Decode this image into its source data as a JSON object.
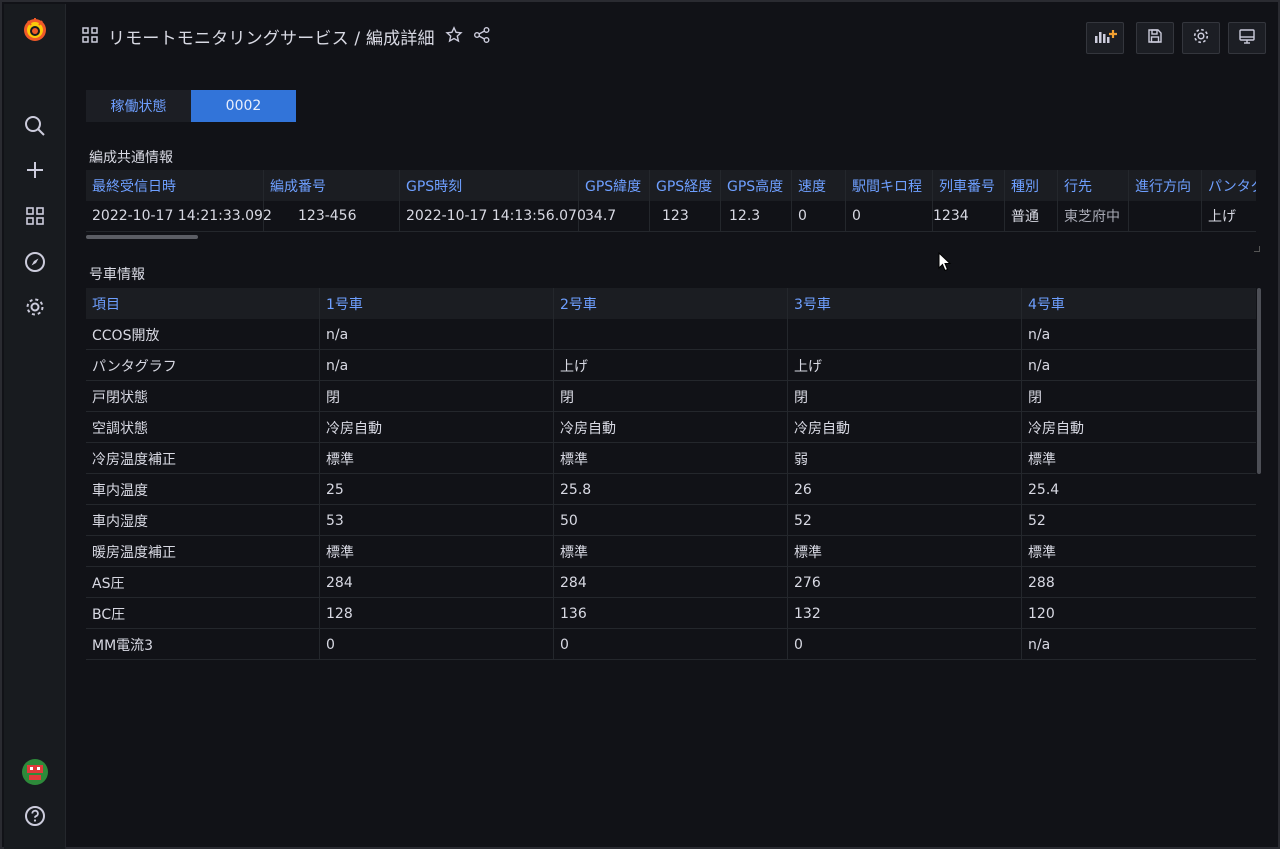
{
  "topbar": {
    "title": "リモートモニタリングサービス / 編成詳細"
  },
  "tabs": [
    {
      "label": "稼働状態"
    },
    {
      "label": "0002"
    }
  ],
  "common_info": {
    "title": "編成共通情報",
    "columns": [
      "最終受信日時",
      "編成番号",
      "GPS時刻",
      "GPS緯度",
      "GPS経度",
      "GPS高度",
      "速度",
      "駅間キロ程",
      "列車番号",
      "種別",
      "行先",
      "進行方向",
      "パンタグ"
    ],
    "row": [
      "2022-10-17 14:21:33.092",
      "123-456",
      "2022-10-17 14:13:56.070",
      "34.7",
      "123",
      "12.3",
      "0",
      "0",
      "1234",
      "普通",
      "東芝府中",
      "",
      "上げ"
    ]
  },
  "car_info": {
    "title": "号車情報",
    "columns": [
      "項目",
      "1号車",
      "2号車",
      "3号車",
      "4号車"
    ],
    "rows": [
      [
        "CCOS開放",
        "n/a",
        "",
        "",
        "n/a"
      ],
      [
        "パンタグラフ",
        "n/a",
        "上げ",
        "上げ",
        "n/a"
      ],
      [
        "戸閉状態",
        "閉",
        "閉",
        "閉",
        "閉"
      ],
      [
        "空調状態",
        "冷房自動",
        "冷房自動",
        "冷房自動",
        "冷房自動"
      ],
      [
        "冷房温度補正",
        "標準",
        "標準",
        "弱",
        "標準"
      ],
      [
        "車内温度",
        "25",
        "25.8",
        "26",
        "25.4"
      ],
      [
        "車内湿度",
        "53",
        "50",
        "52",
        "52"
      ],
      [
        "暖房温度補正",
        "標準",
        "標準",
        "標準",
        "標準"
      ],
      [
        "AS圧",
        "284",
        "284",
        "276",
        "288"
      ],
      [
        "BC圧",
        "128",
        "136",
        "132",
        "120"
      ],
      [
        "MM電流3",
        "0",
        "0",
        "0",
        "n/a"
      ]
    ]
  },
  "colors": {
    "accent": "#3274d9",
    "link": "#6e9fff",
    "background": "#111217",
    "logo": "#f05a28"
  },
  "icons": [
    "grafana-logo-icon",
    "search-icon",
    "plus-icon",
    "dashboards-icon",
    "explore-icon",
    "gear-icon",
    "avatar",
    "help-icon",
    "dashboard-grid-icon",
    "star-icon",
    "share-icon",
    "add-panel-icon",
    "save-icon",
    "settings-icon",
    "tv-mode-icon"
  ]
}
